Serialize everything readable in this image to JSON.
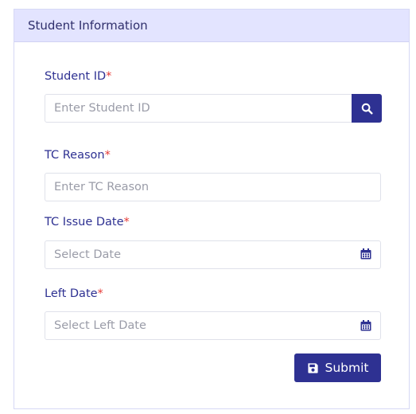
{
  "card": {
    "title": "Student Information"
  },
  "form": {
    "student_id": {
      "label": "Student ID",
      "required_mark": "*",
      "placeholder": "Enter Student ID"
    },
    "tc_reason": {
      "label": "TC Reason",
      "required_mark": "*",
      "placeholder": "Enter TC Reason"
    },
    "tc_issue_date": {
      "label": "TC Issue Date",
      "required_mark": "*",
      "placeholder": "Select Date"
    },
    "left_date": {
      "label": "Left Date",
      "required_mark": "*",
      "placeholder": "Select Left Date"
    },
    "submit_label": "Submit"
  },
  "icons": {
    "search": "search-icon",
    "calendar": "calendar-icon",
    "save": "floppy-disk-icon"
  },
  "colors": {
    "primary": "#2e3192",
    "header_bg": "#e3e4ff",
    "required": "#e53935"
  }
}
